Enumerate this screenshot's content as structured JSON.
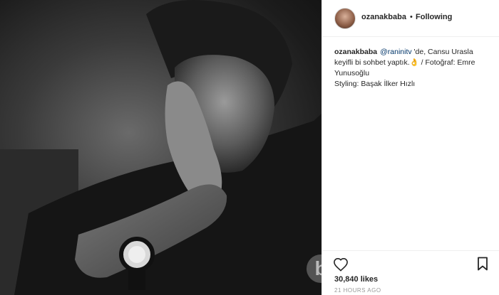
{
  "header": {
    "username": "ozanakbaba",
    "separator": "•",
    "follow_status": "Following"
  },
  "caption": {
    "username": "ozanakbaba",
    "mention": "@raninitv",
    "text": " 'de, Cansu Urasla keyifli bi sohbet yaptık.👌 / Fotoğraf: Emre Yunusoğlu",
    "styling": "Styling: Başak İlker Hızlı"
  },
  "stats": {
    "likes": "30,840 likes",
    "time": "21 HOURS AGO"
  },
  "icons": {
    "heart": "heart-icon",
    "bookmark": "bookmark-icon"
  },
  "colors": {
    "mention": "#003569",
    "text": "#262626",
    "muted": "#999999"
  }
}
